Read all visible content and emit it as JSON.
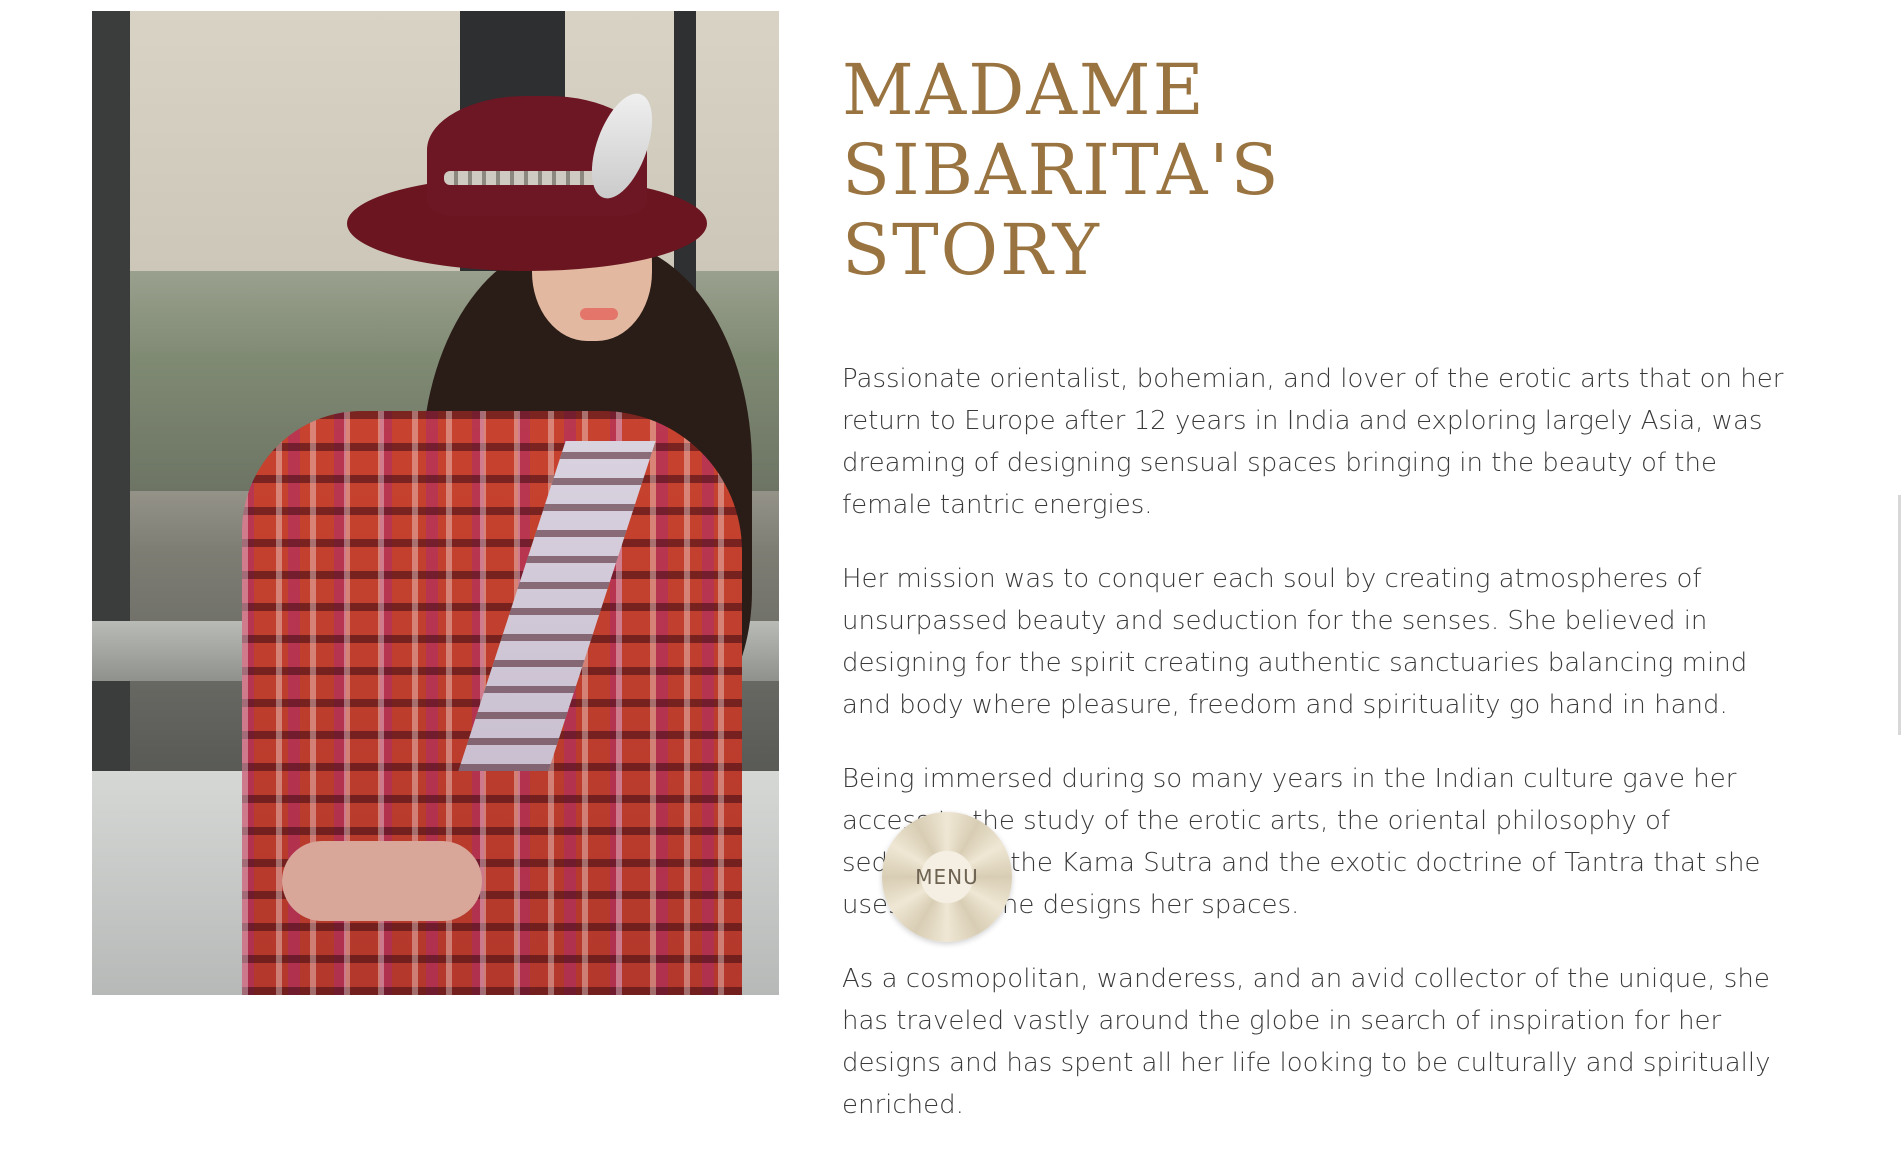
{
  "page": {
    "accent_color": "#9a7440",
    "text_color": "#3a3a3a"
  },
  "hero_image": {
    "icon": "portrait-photo",
    "alt": "Madame Sibarita portrait"
  },
  "story": {
    "title_lines": [
      "MADAME",
      "SIBARITA'S",
      "STORY"
    ],
    "paragraphs": [
      "Passionate orientalist, bohemian, and lover of the erotic arts that on her return to Europe after 12 years in India and exploring largely Asia, was dreaming of designing sensual spaces bringing in the beauty of the female tantric energies.",
      "Her mission was to conquer each soul by creating atmospheres of unsurpassed beauty and seduction for the senses. She believed in designing for the spirit creating authentic sanctuaries balancing mind and body where pleasure, freedom and spirituality go hand in hand.",
      "Being immersed during so many years in the Indian culture gave her access to the study of the erotic arts, the oriental philosophy of seduction of the Kama Sutra and the exotic doctrine of Tantra that she uses when she designs her spaces.",
      "As a cosmopolitan, wanderess, and an avid collector of the unique, she has traveled vastly around the globe in search of inspiration for her designs and has spent all her life looking to be culturally and spiritually enriched."
    ]
  },
  "menu": {
    "label": "MENU",
    "icon": "flower-badge-icon"
  }
}
